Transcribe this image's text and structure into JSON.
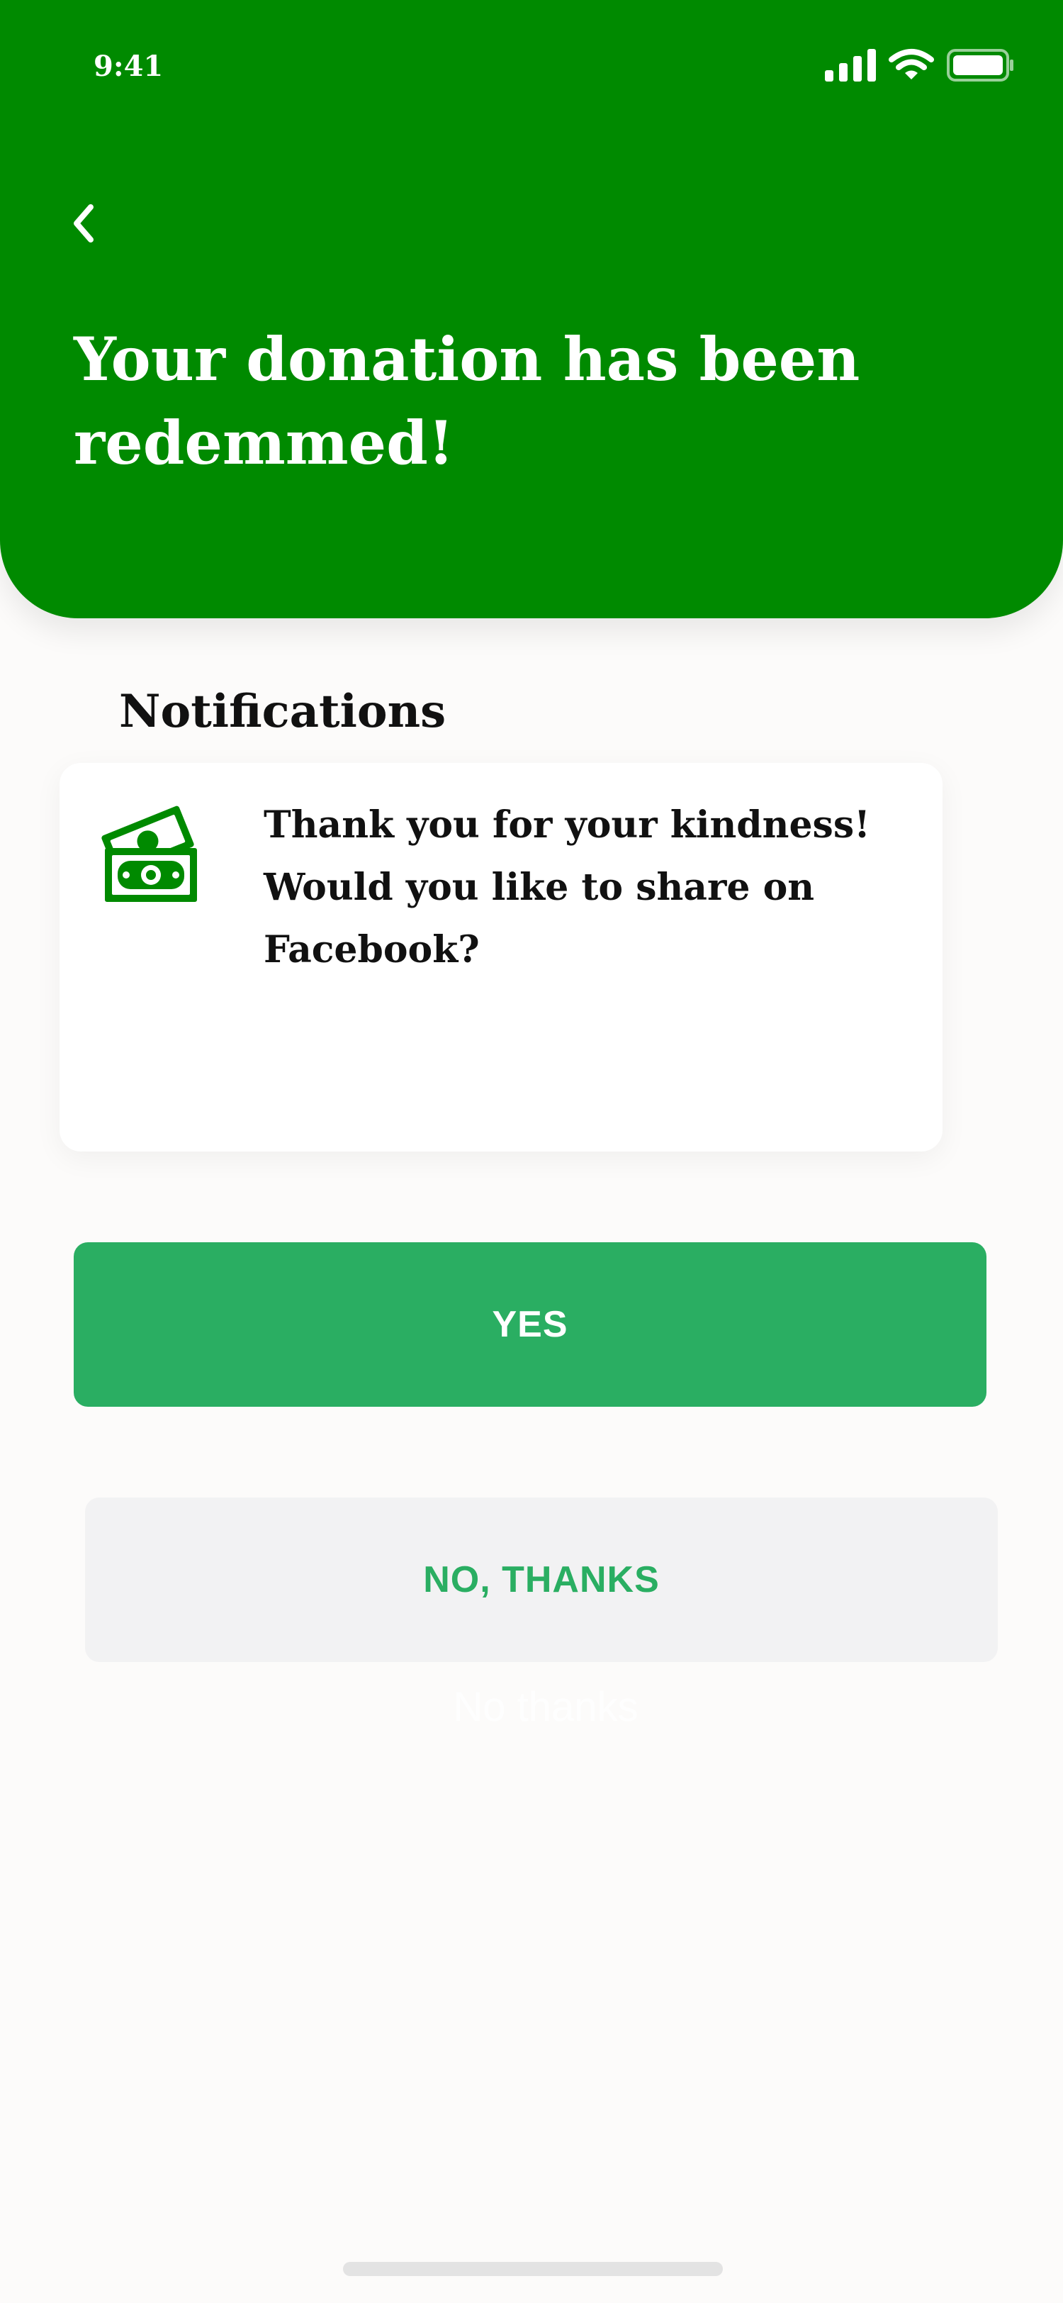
{
  "status_bar": {
    "time": "9:41",
    "icons": [
      "signal-icon",
      "wifi-icon",
      "battery-icon"
    ]
  },
  "header": {
    "back_icon": "chevron-left-icon",
    "title": "Your donation has been redemmed!",
    "background_color": "#008a00"
  },
  "notifications": {
    "section_title": "Notifications",
    "card": {
      "icon": "money-icon",
      "message": "Thank you for your kindness! Would you like to share on Facebook?"
    }
  },
  "actions": {
    "yes_label": "YES",
    "no_label": "NO, THANKS",
    "ghost_label": "No thanks"
  },
  "colors": {
    "accent_green": "#2aae62",
    "header_green": "#008a00",
    "secondary_button_bg": "#f2f2f3"
  }
}
